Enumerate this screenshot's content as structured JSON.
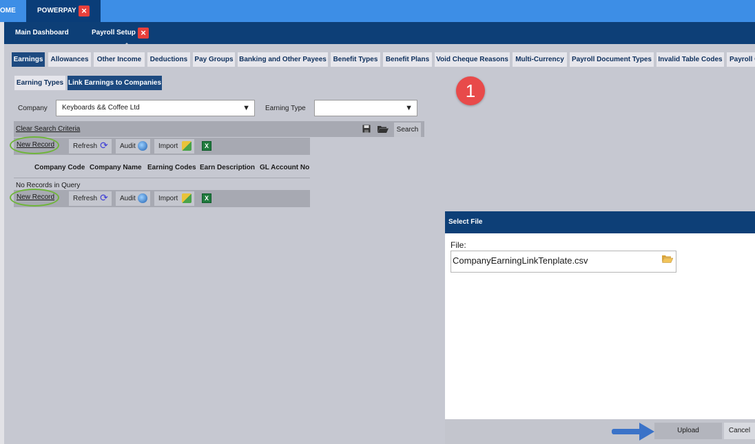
{
  "top_tabs": {
    "home": "OME",
    "powerpay": "POWERPAY"
  },
  "nav": {
    "main_dashboard": "Main Dashboard",
    "payroll_setup": "Payroll Setup"
  },
  "section_tabs": [
    "Earnings",
    "Allowances",
    "Other Income",
    "Deductions",
    "Pay Groups",
    "Banking and Other Payees",
    "Benefit Types",
    "Benefit Plans",
    "Void Cheque Reasons",
    "Multi-Currency",
    "Payroll Document Types",
    "Invalid Table Codes",
    "Payroll C"
  ],
  "sub_tabs": [
    "Earning Types",
    "Link Earnings to Companies"
  ],
  "form": {
    "company_label": "Company",
    "company_value": "Keyboards && Coffee Ltd",
    "earning_type_label": "Earning Type",
    "earning_type_value": "",
    "clear_search": "Clear Search Criteria",
    "search_label": "Search"
  },
  "toolbar": {
    "new_record": "New Record",
    "refresh": "Refresh",
    "audit": "Audit",
    "import": "Import",
    "excel": "X"
  },
  "grid": {
    "columns": [
      "Company Code",
      "Company Name",
      "Earning Codes",
      "Earn Description",
      "GL Account No"
    ],
    "empty_text": "No Records in Query"
  },
  "badge": "1",
  "dialog": {
    "title": "Select File",
    "file_label": "File:",
    "file_value": "CompanyEarningLinkTenplate.csv",
    "upload": "Upload",
    "cancel": "Cancel"
  },
  "colors": {
    "accent_blue": "#0d3f77",
    "top_blue": "#3d8ee6",
    "badge_red": "#e84a4a",
    "highlight_green": "#6fb53a"
  }
}
